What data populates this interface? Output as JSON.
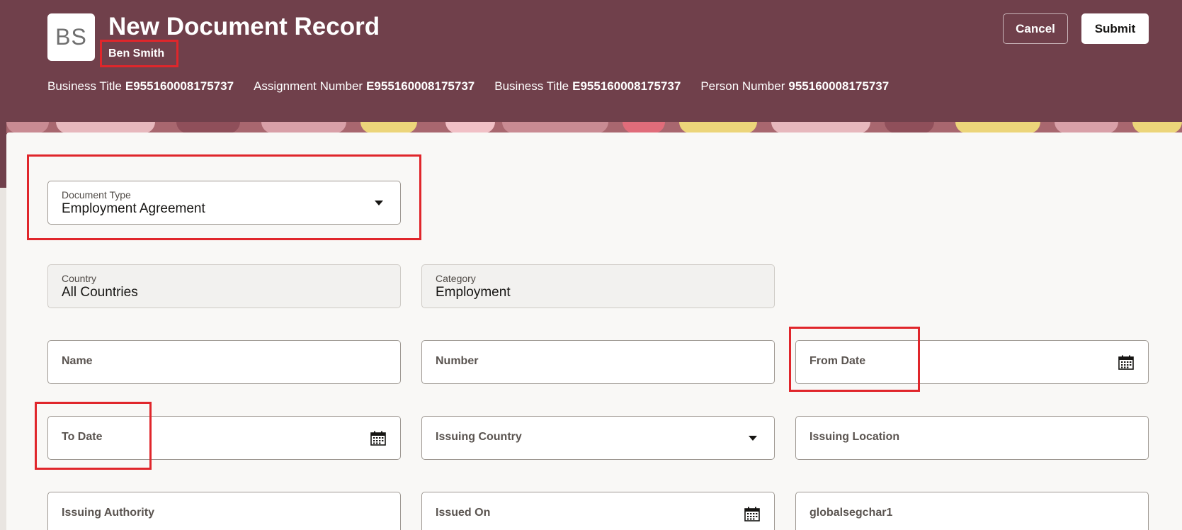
{
  "header": {
    "avatar_initials": "BS",
    "title": "New Document Record",
    "person_name": "Ben Smith",
    "cancel_label": "Cancel",
    "submit_label": "Submit",
    "meta": [
      {
        "label": "Business Title",
        "value": "E955160008175737"
      },
      {
        "label": "Assignment Number",
        "value": "E955160008175737"
      },
      {
        "label": "Business Title",
        "value": "E955160008175737"
      },
      {
        "label": "Person Number",
        "value": "955160008175737"
      }
    ]
  },
  "form": {
    "document_type": {
      "label": "Document Type",
      "value": "Employment Agreement"
    },
    "country": {
      "label": "Country",
      "value": "All Countries"
    },
    "category": {
      "label": "Category",
      "value": "Employment"
    },
    "name": {
      "label": "Name"
    },
    "number": {
      "label": "Number"
    },
    "from_date": {
      "label": "From Date"
    },
    "to_date": {
      "label": "To Date"
    },
    "issuing_country": {
      "label": "Issuing Country"
    },
    "issuing_location": {
      "label": "Issuing Location"
    },
    "issuing_authority": {
      "label": "Issuing Authority"
    },
    "issued_on": {
      "label": "Issued On"
    },
    "globalsegchar1": {
      "label": "globalsegchar1"
    }
  },
  "colors": {
    "header_bg": "#70404b",
    "highlight": "#e0262b"
  }
}
